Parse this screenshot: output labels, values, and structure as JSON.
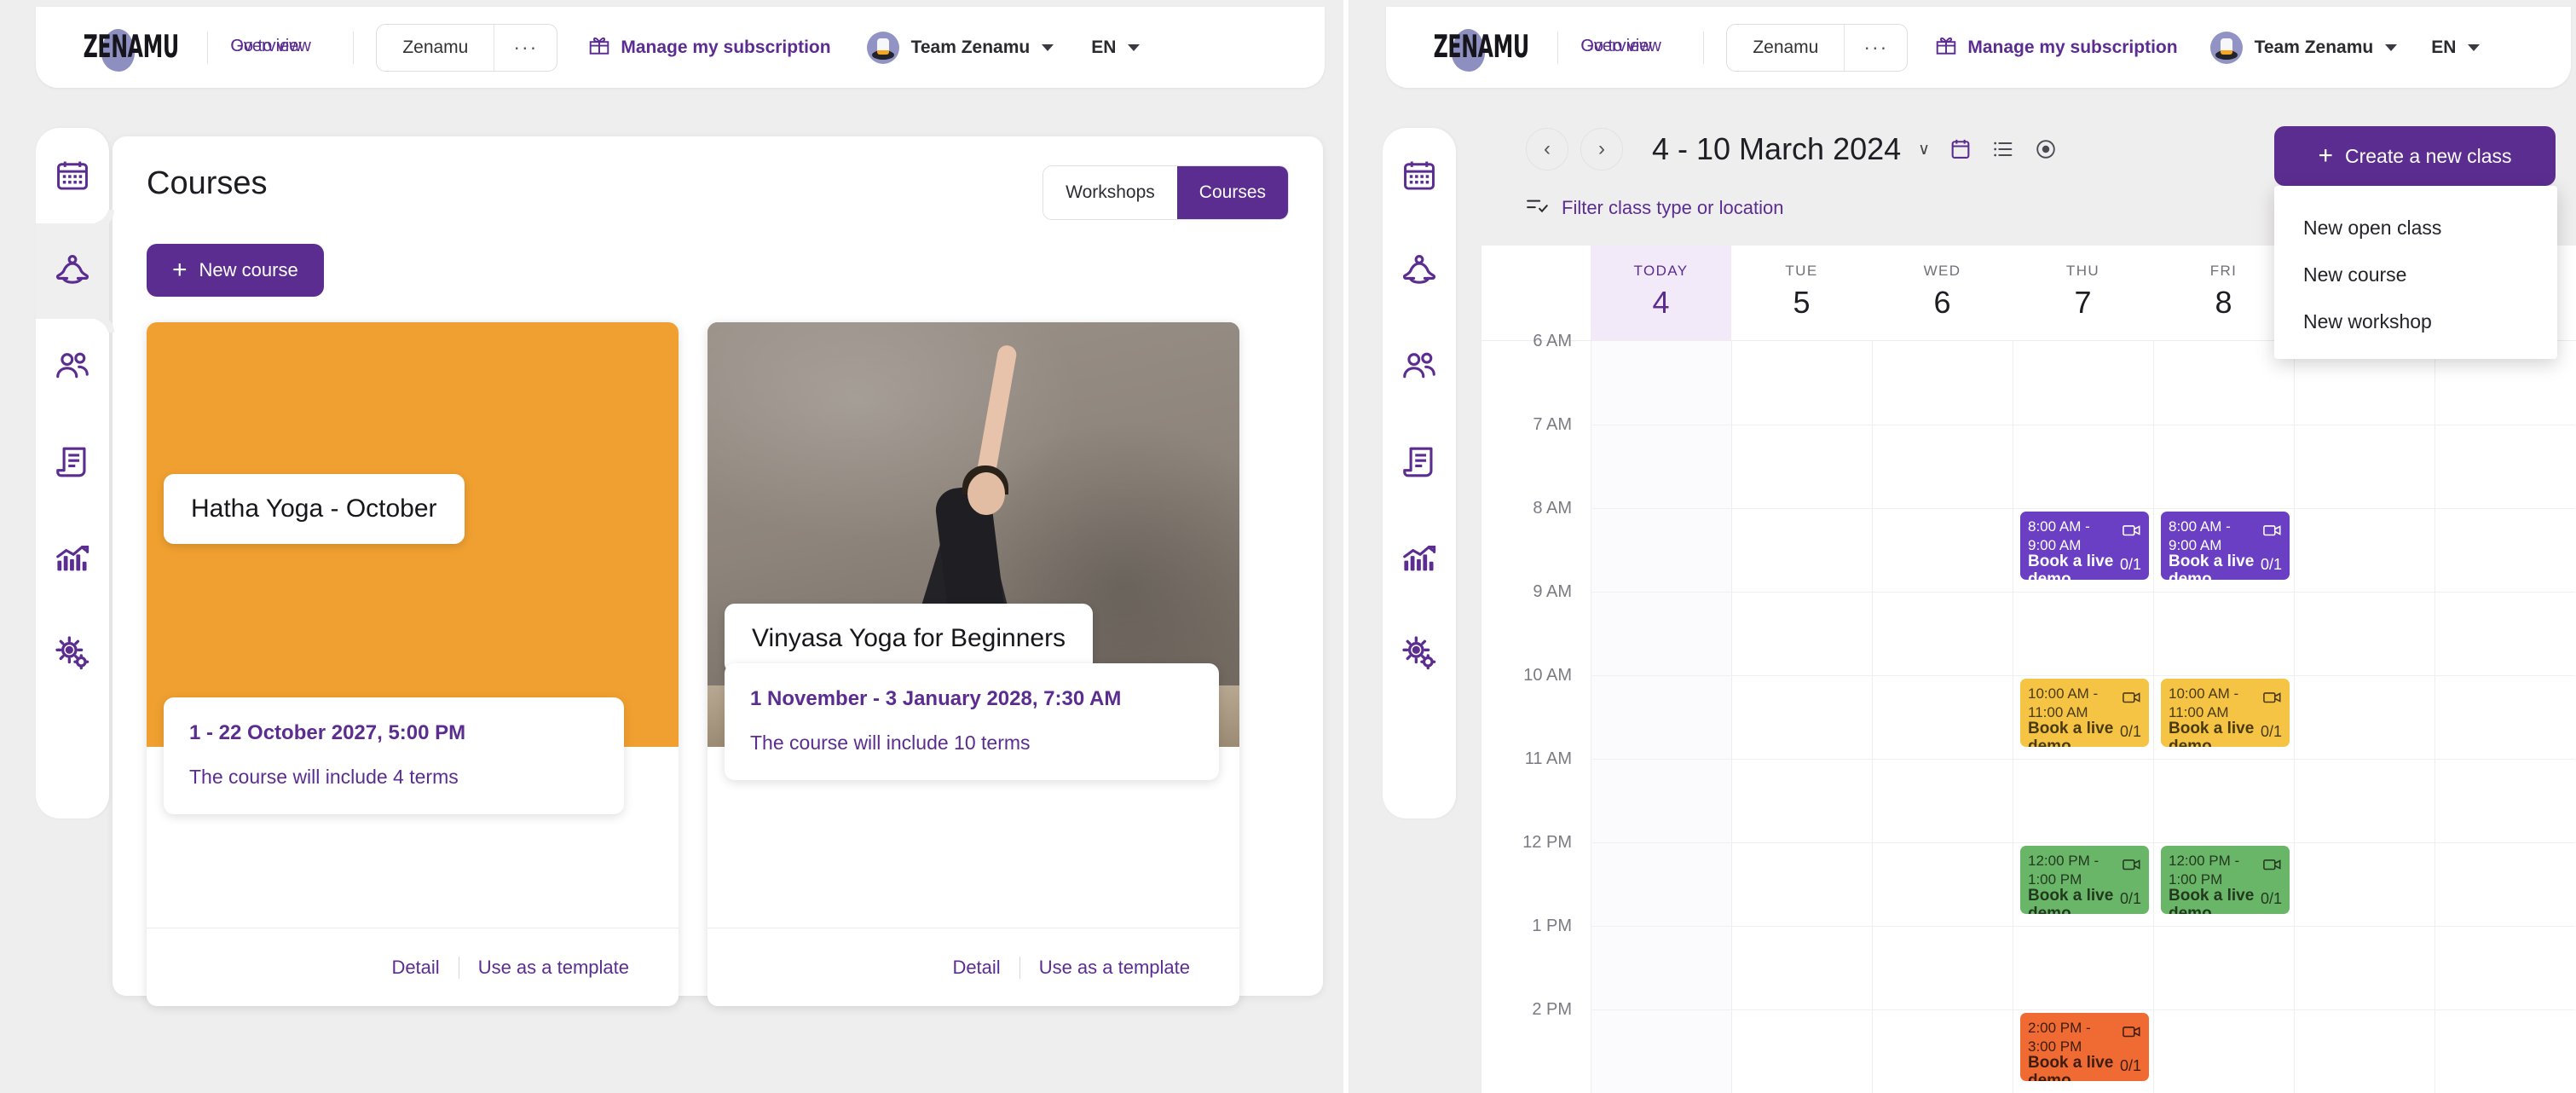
{
  "header": {
    "logo_text": "ZENAMU",
    "nav_overlap": [
      "Overview",
      "Go to view"
    ],
    "org_switch": {
      "name": "Zenamu",
      "more": "···"
    },
    "subscription_label": "Manage my subscription",
    "team_label": "Team Zenamu",
    "language": "EN"
  },
  "sidebar": {
    "items": [
      {
        "name": "calendar",
        "label": "Calendar"
      },
      {
        "name": "classes",
        "label": "Classes"
      },
      {
        "name": "clients",
        "label": "Clients"
      },
      {
        "name": "invoices",
        "label": "Invoices"
      },
      {
        "name": "statistics",
        "label": "Statistics"
      },
      {
        "name": "settings",
        "label": "Settings"
      }
    ],
    "active_index": 1
  },
  "courses_panel": {
    "title": "Courses",
    "segmented": {
      "left": "Workshops",
      "right": "Courses",
      "selected": "Courses"
    },
    "new_course_label": "New course",
    "new_course_plus": "+",
    "cards": [
      {
        "title": "Hatha Yoga - October",
        "date": "1 - 22 October 2027, 5:00 PM",
        "terms": "The course will include 4 terms",
        "detail_label": "Detail",
        "template_label": "Use as a template",
        "media": "orange"
      },
      {
        "title": "Vinyasa Yoga for Beginners",
        "date": "1 November - 3 January 2028, 7:30 AM",
        "terms": "The course will include 10 terms",
        "detail_label": "Detail",
        "template_label": "Use as a template",
        "media": "photo"
      }
    ]
  },
  "calendar": {
    "prev_label": "‹",
    "next_label": "›",
    "range": "4 - 10 March 2024",
    "range_caret": "∨",
    "filter_label": "Filter class type or location",
    "create_button": "Create a new class",
    "create_plus": "+",
    "create_menu": [
      "New open class",
      "New course",
      "New workshop"
    ],
    "days": [
      {
        "dow": "TODAY",
        "num": "4",
        "today": true
      },
      {
        "dow": "TUE",
        "num": "5",
        "today": false
      },
      {
        "dow": "WED",
        "num": "6",
        "today": false
      },
      {
        "dow": "THU",
        "num": "7",
        "today": false
      },
      {
        "dow": "FRI",
        "num": "8",
        "today": false
      },
      {
        "dow": "",
        "num": "",
        "today": false
      },
      {
        "dow": "",
        "num": "",
        "today": false
      }
    ],
    "hours": [
      "6 AM",
      "7 AM",
      "8 AM",
      "9 AM",
      "10 AM",
      "11 AM",
      "12 PM",
      "1 PM",
      "2 PM"
    ],
    "events": [
      {
        "time": "8:00 AM - 9:00 AM",
        "title": "Book a live demo",
        "count": "0/1",
        "color": "purple",
        "day": 3,
        "hour_index": 2
      },
      {
        "time": "8:00 AM - 9:00 AM",
        "title": "Book a live demo",
        "count": "0/1",
        "color": "purple",
        "day": 4,
        "hour_index": 2
      },
      {
        "time": "10:00 AM - 11:00 AM",
        "title": "Book a live demo",
        "count": "0/1",
        "color": "amber",
        "day": 3,
        "hour_index": 4
      },
      {
        "time": "10:00 AM - 11:00 AM",
        "title": "Book a live demo",
        "count": "0/1",
        "color": "amber",
        "day": 4,
        "hour_index": 4
      },
      {
        "time": "12:00 PM - 1:00 PM",
        "title": "Book a live demo",
        "count": "0/1",
        "color": "green",
        "day": 3,
        "hour_index": 6
      },
      {
        "time": "12:00 PM - 1:00 PM",
        "title": "Book a live demo",
        "count": "0/1",
        "color": "green",
        "day": 4,
        "hour_index": 6
      },
      {
        "time": "2:00 PM - 3:00 PM",
        "title": "Book a live demo",
        "count": "0/1",
        "color": "orange",
        "day": 3,
        "hour_index": 8
      }
    ]
  },
  "colors": {
    "brand_purple": "#5b2d90",
    "event_purple": "#6b3fc4",
    "event_amber": "#f5c444",
    "event_green": "#69b668",
    "event_orange": "#ef6b33",
    "card_orange": "#f0a030",
    "today_tint": "#f2eaf9"
  }
}
